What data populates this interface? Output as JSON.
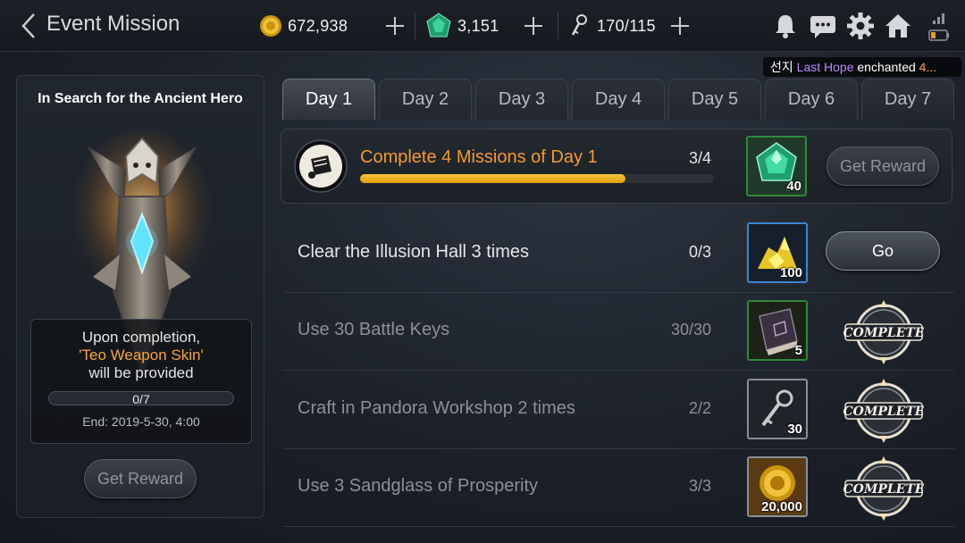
{
  "header": {
    "title": "Event Mission",
    "gold": "672,938",
    "gems": "3,151",
    "keys": "170/115"
  },
  "ticker": {
    "who": "선지",
    "item": "Last Hope",
    "action": "enchanted",
    "level": "4..."
  },
  "left_panel": {
    "title": "In Search for the Ancient Hero",
    "line1": "Upon completion,",
    "line2": "'Teo Weapon Skin'",
    "line3": "will be provided",
    "progress_text": "0/7",
    "progress": 0,
    "end": "End: 2019-5-30, 4:00",
    "button": "Get Reward"
  },
  "tabs": [
    "Day 1",
    "Day 2",
    "Day 3",
    "Day 4",
    "Day 5",
    "Day 6",
    "Day 7"
  ],
  "main_mission": {
    "title": "Complete 4 Missions of Day 1",
    "count": "3/4",
    "progress": 0.75,
    "reward_qty": "40",
    "button": "Get Reward"
  },
  "missions": [
    {
      "name": "Clear the Illusion Hall 3 times",
      "count": "0/3",
      "reward_qty": "100",
      "reward_icon": "gold-pile-icon",
      "button": "Go"
    },
    {
      "name": "Use 30 Battle Keys",
      "count": "30/30",
      "reward_qty": "5",
      "reward_icon": "book-icon",
      "status": "COMPLETE"
    },
    {
      "name": "Craft in Pandora Workshop 2 times",
      "count": "2/2",
      "reward_qty": "30",
      "reward_icon": "key-icon",
      "status": "COMPLETE"
    },
    {
      "name": "Use 3 Sandglass of Prosperity",
      "count": "3/3",
      "reward_qty": "20,000",
      "reward_icon": "gold-coin-icon",
      "status": "COMPLETE"
    }
  ],
  "colors": {
    "accent_orange": "#f59a2c",
    "progress_yellow": "#e9b21b",
    "rare_green": "#2f8a3a",
    "rare_blue": "#3a86d6"
  }
}
